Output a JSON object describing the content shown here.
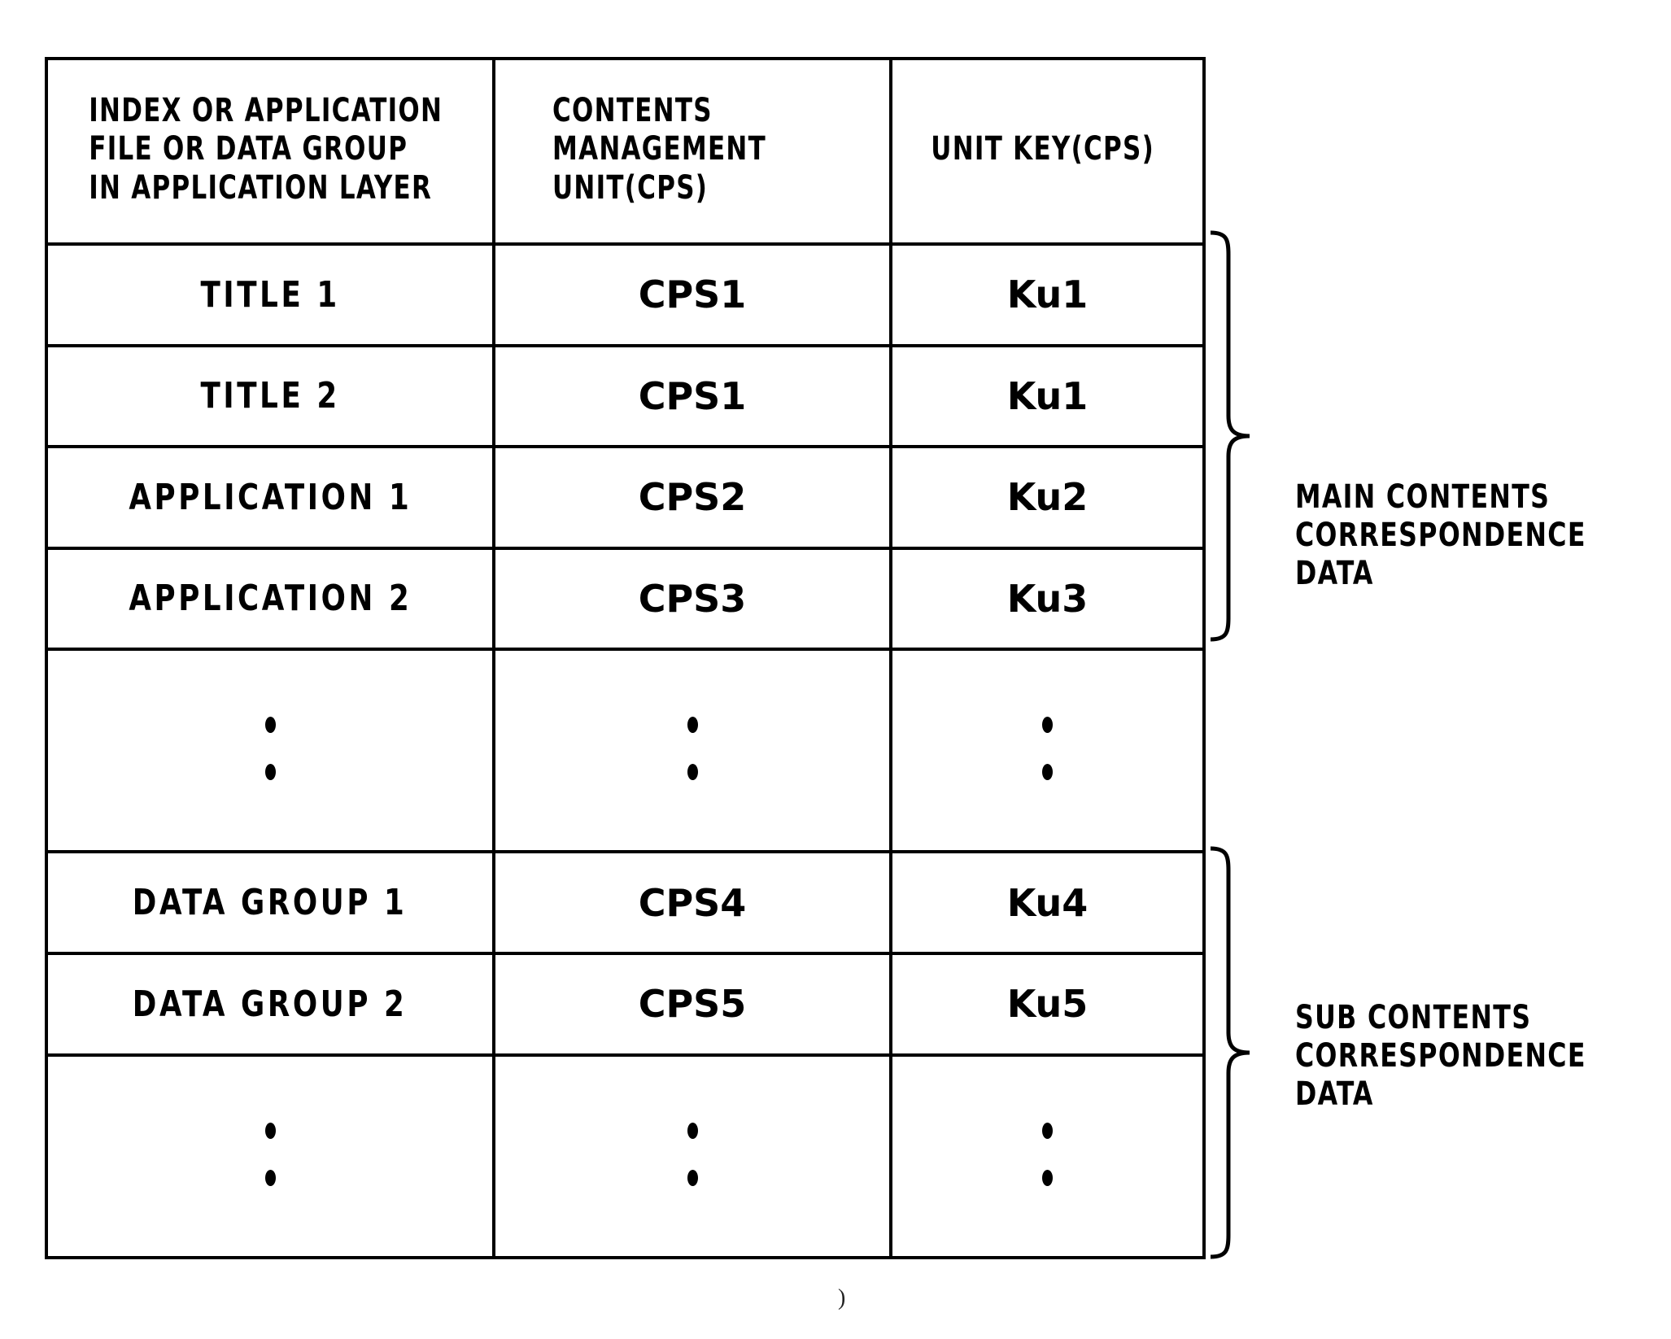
{
  "figure": {
    "bottom_mark": ")"
  },
  "table": {
    "headers": {
      "col1": [
        "INDEX OR APPLICATION",
        "FILE OR DATA GROUP",
        "IN APPLICATION LAYER"
      ],
      "col2": [
        "CONTENTS",
        "MANAGEMENT",
        "UNIT(CPS)"
      ],
      "col3": [
        "UNIT KEY(CPS)"
      ]
    },
    "rows": [
      {
        "type": "data",
        "label": "TITLE 1",
        "cps": "CPS1",
        "key": "Ku1"
      },
      {
        "type": "data",
        "label": "TITLE 2",
        "cps": "CPS1",
        "key": "Ku1"
      },
      {
        "type": "data",
        "label": "APPLICATION 1",
        "cps": "CPS2",
        "key": "Ku2"
      },
      {
        "type": "data",
        "label": "APPLICATION 2",
        "cps": "CPS3",
        "key": "Ku3"
      },
      {
        "type": "ellipsis",
        "label": "⋮",
        "cps": "⋮",
        "key": "⋮"
      },
      {
        "type": "data",
        "label": "DATA GROUP 1",
        "cps": "CPS4",
        "key": "Ku4"
      },
      {
        "type": "data",
        "label": "DATA GROUP 2",
        "cps": "CPS5",
        "key": "Ku5"
      },
      {
        "type": "ellipsis",
        "label": "⋮",
        "cps": "⋮",
        "key": "⋮"
      }
    ]
  },
  "annotations": {
    "main": [
      "MAIN CONTENTS",
      "CORRESPONDENCE",
      "DATA"
    ],
    "sub": [
      "SUB CONTENTS",
      "CORRESPONDENCE",
      "DATA"
    ]
  },
  "colors": {
    "ink": "#000000",
    "paper": "#ffffff"
  }
}
